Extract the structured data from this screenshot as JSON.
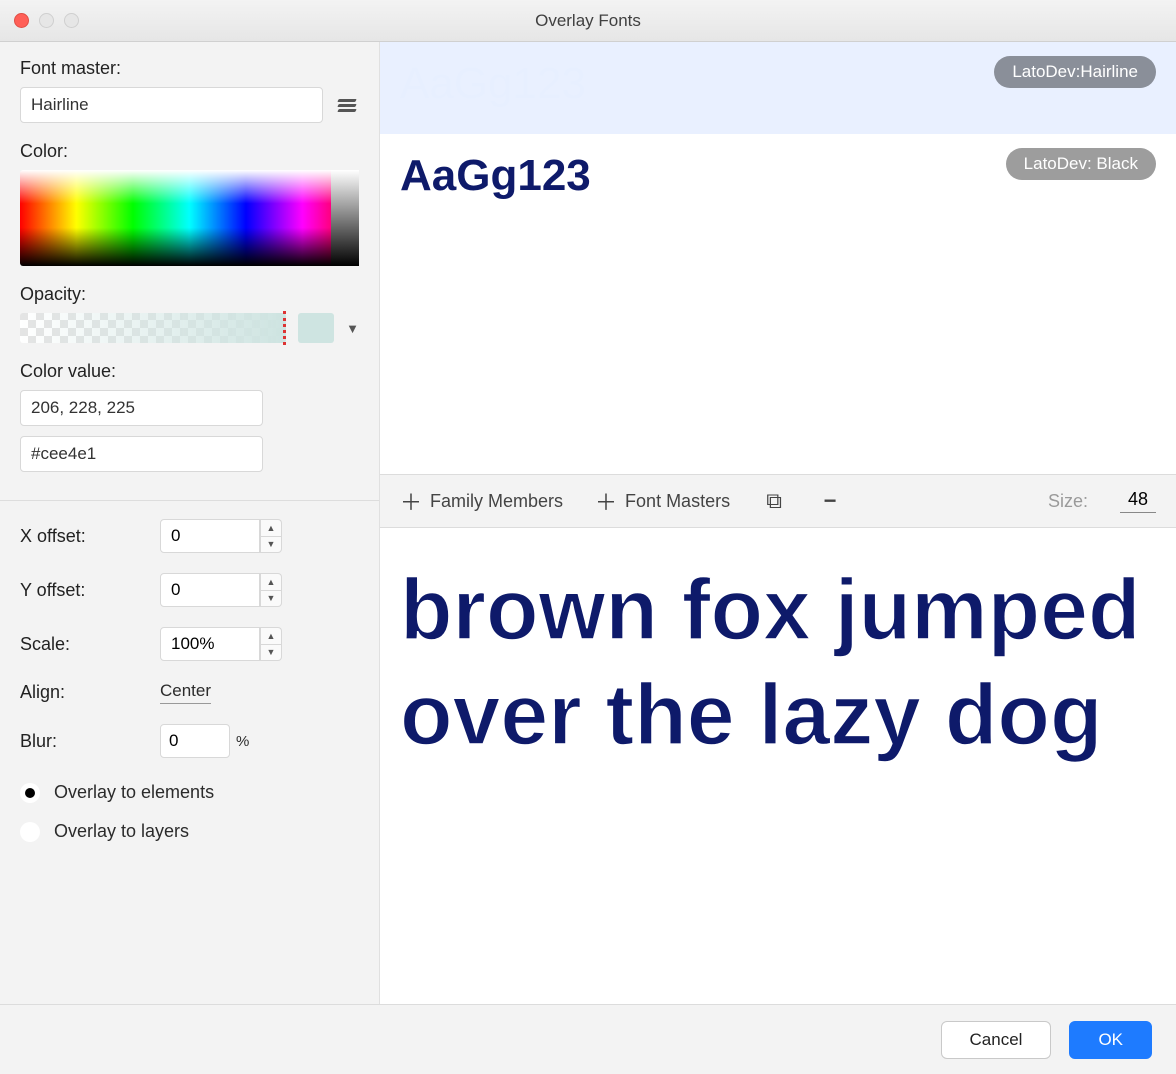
{
  "title": "Overlay Fonts",
  "sidebar": {
    "font_master_label": "Font master:",
    "font_master_value": "Hairline",
    "color_label": "Color:",
    "opacity_label": "Opacity:",
    "color_value_label": "Color value:",
    "rgb_value": "206, 228, 225",
    "hex_value": "#cee4e1",
    "x_offset_label": "X offset:",
    "x_offset_value": "0",
    "y_offset_label": "Y offset:",
    "y_offset_value": "0",
    "scale_label": "Scale:",
    "scale_value": "100%",
    "align_label": "Align:",
    "align_value": "Center",
    "blur_label": "Blur:",
    "blur_value": "0",
    "blur_unit": "%",
    "radio_elements": "Overlay to elements",
    "radio_layers": "Overlay to layers"
  },
  "preview": {
    "rows": [
      {
        "sample": "AaGg123",
        "badge": "LatoDev:Hairline"
      },
      {
        "sample": "AaGg123",
        "badge": "LatoDev: Black"
      }
    ]
  },
  "toolbar": {
    "family_members": "Family Members",
    "font_masters": "Font Masters",
    "size_label": "Size:",
    "size_value": "48"
  },
  "canvas": {
    "text": "brown fox jumped over the lazy dog"
  },
  "footer": {
    "cancel": "Cancel",
    "ok": "OK"
  }
}
